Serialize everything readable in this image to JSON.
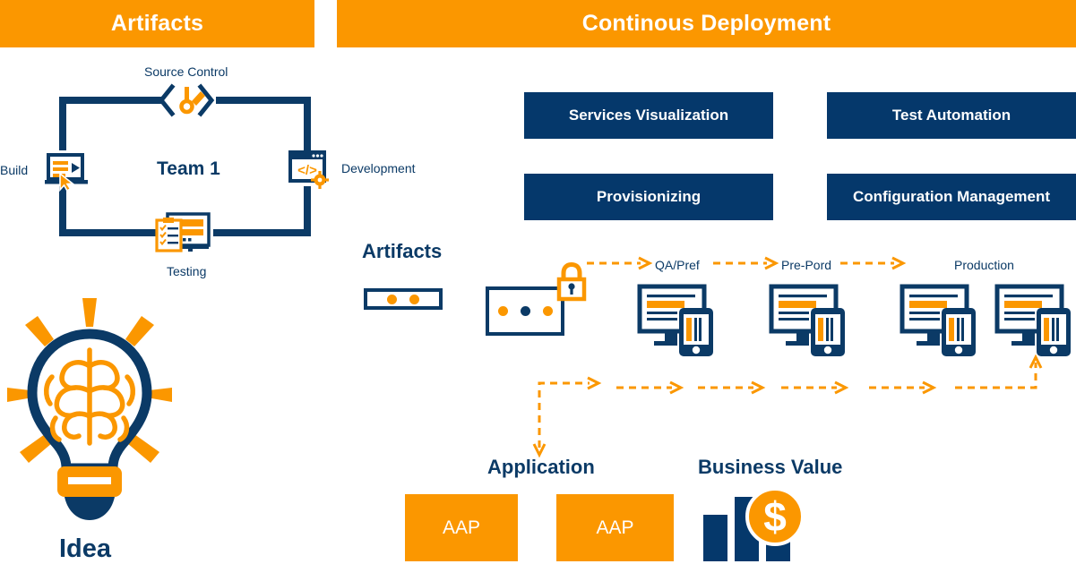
{
  "headers": {
    "left": "Artifacts",
    "right": "Continous Deployment"
  },
  "cycle": {
    "center": "Team 1",
    "top": "Source Control",
    "left": "Build",
    "right": "Development",
    "bottom": "Testing"
  },
  "idea": {
    "label": "Idea",
    "icon": "lightbulb-brain-icon"
  },
  "practices": [
    {
      "label": "Services Visualization"
    },
    {
      "label": "Test Automation"
    },
    {
      "label": "Provisionizing"
    },
    {
      "label": "Configuration Management"
    }
  ],
  "pipeline": {
    "artifacts_label": "Artifacts",
    "stages": [
      {
        "label": "QA/Pref"
      },
      {
        "label": "Pre-Pord"
      },
      {
        "label": "Production"
      }
    ],
    "lock_icon": "lock-icon",
    "device_icon": "monitor-phone-icon"
  },
  "bottom": {
    "application_label": "Application",
    "business_value_label": "Business Value",
    "apps": [
      {
        "label": "AAP"
      },
      {
        "label": "AAP"
      }
    ],
    "value_icon": "bar-chart-dollar-icon",
    "currency_symbol": "$"
  },
  "colors": {
    "orange": "#FB9700",
    "navy": "#05386b",
    "navy_text": "#0b3a66",
    "white": "#ffffff"
  }
}
